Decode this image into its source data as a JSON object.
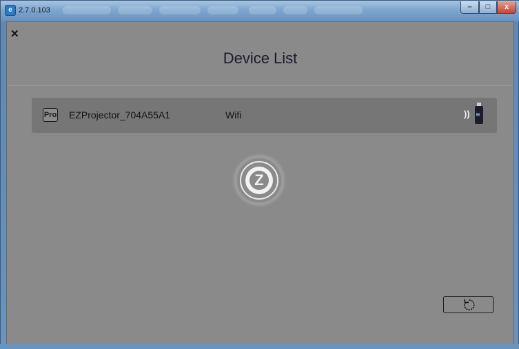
{
  "window": {
    "version": "2.7.0.103",
    "app_icon": "ez-app-icon",
    "controls": {
      "minimize": "minimize-icon",
      "maximize": "maximize-icon",
      "close": "close-icon"
    }
  },
  "header": {
    "close_icon": "close-icon",
    "title": "Device List"
  },
  "devices": [
    {
      "badge": "Pro",
      "name": "EZProjector_704A55A1",
      "connection": "Wifi",
      "status_icons": [
        "wifi-signal-icon",
        "usb-dongle-icon"
      ]
    }
  ],
  "spinner": {
    "icon": "ez-logo-loading-icon",
    "letter": "Z"
  },
  "footer": {
    "refresh_icon": "refresh-icon"
  },
  "colors": {
    "panel_bg": "#8a8a8a",
    "row_bg": "#767676",
    "title_text": "#1b1b2e"
  }
}
